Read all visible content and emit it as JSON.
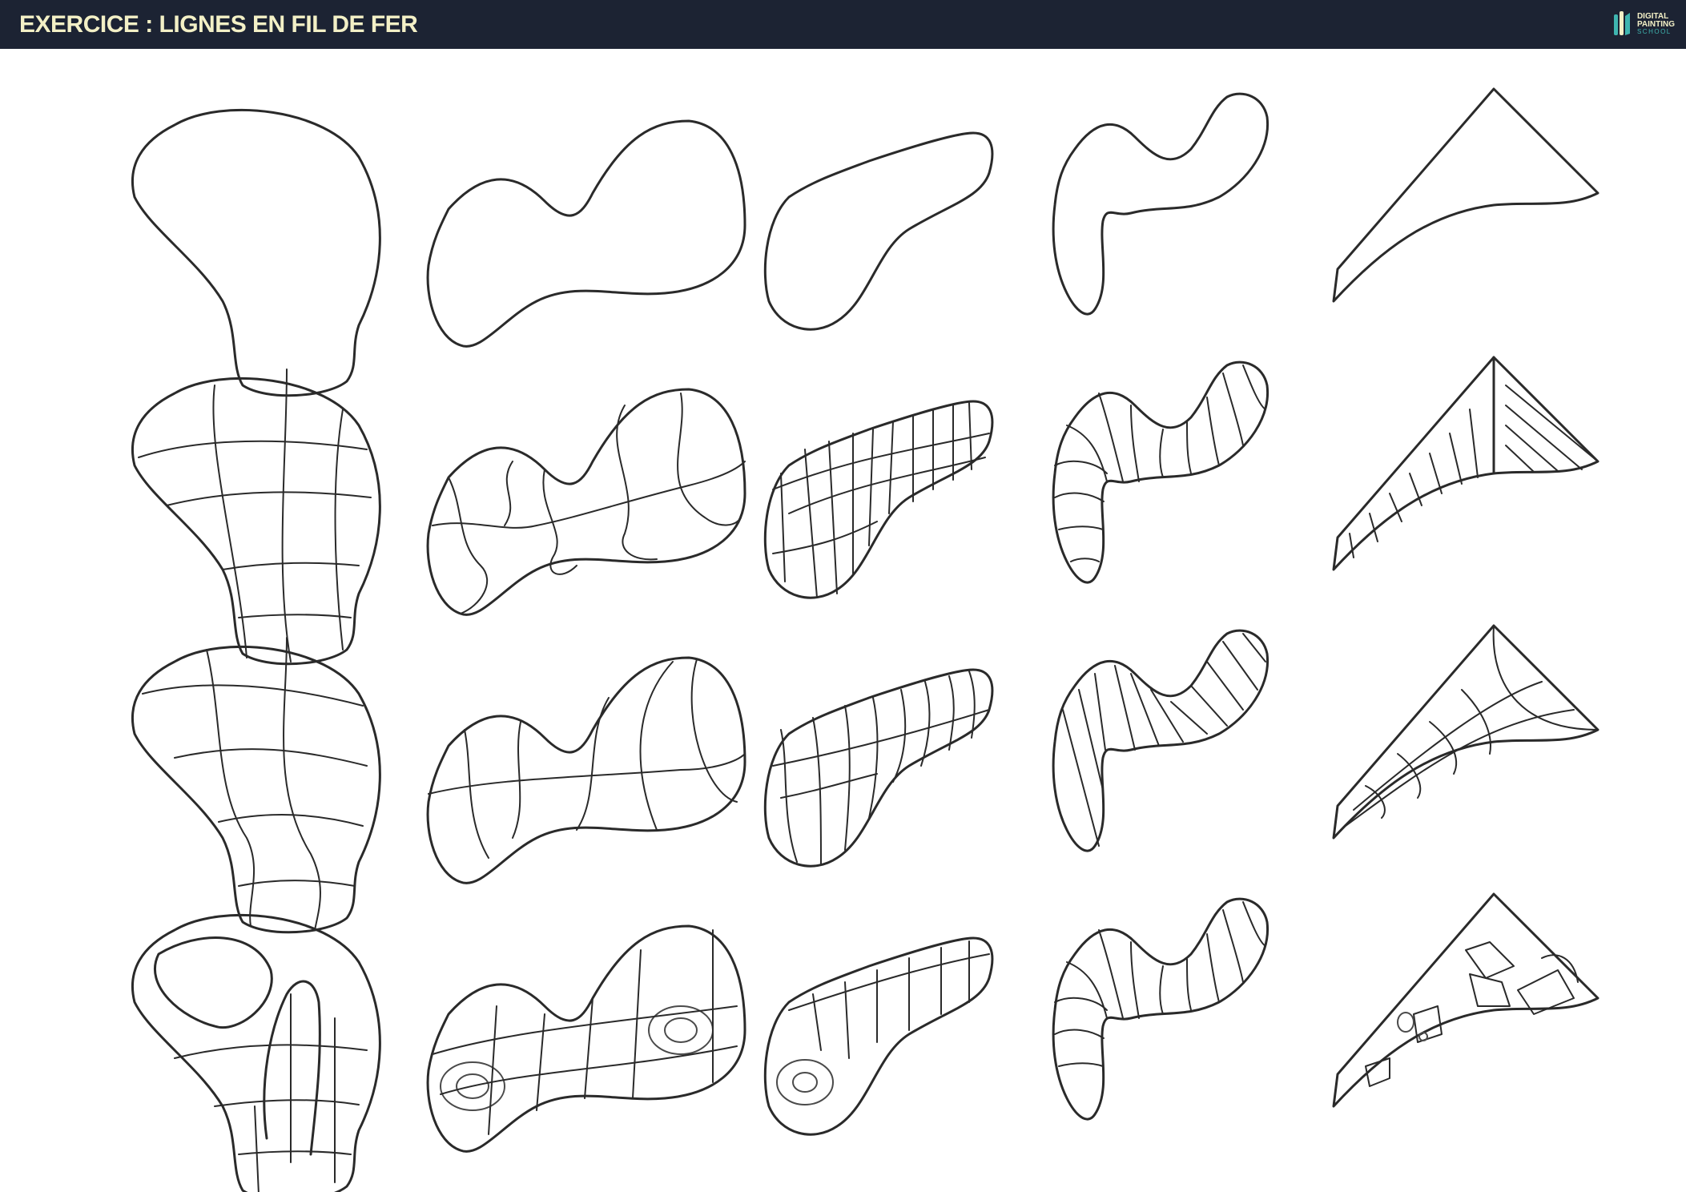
{
  "header": {
    "title": "EXERCICE : LIGNES EN FIL DE FER",
    "logo": {
      "line1": "DIGITAL",
      "line2": "PAINTING",
      "line3": "SCHOOL",
      "icon": "brush-logo-icon"
    }
  },
  "sheet": {
    "rows": [
      {
        "name": "row-outlines",
        "shapes": [
          "blob-1",
          "blob-2",
          "blob-3",
          "blob-4",
          "wedge-5"
        ]
      },
      {
        "name": "row-wireframe-a",
        "shapes": [
          "blob-1",
          "blob-2",
          "blob-3",
          "blob-4",
          "wedge-5"
        ]
      },
      {
        "name": "row-wireframe-b",
        "shapes": [
          "blob-1",
          "blob-2",
          "blob-3",
          "blob-4",
          "wedge-5"
        ]
      },
      {
        "name": "row-wireframe-c",
        "shapes": [
          "blob-1",
          "blob-2",
          "blob-3",
          "blob-4",
          "wedge-5"
        ]
      }
    ]
  },
  "colors": {
    "header_bg": "#1c2333",
    "title": "#f3f0c6",
    "logo_accent": "#3fb5b0",
    "line": "#2a2a2a"
  }
}
